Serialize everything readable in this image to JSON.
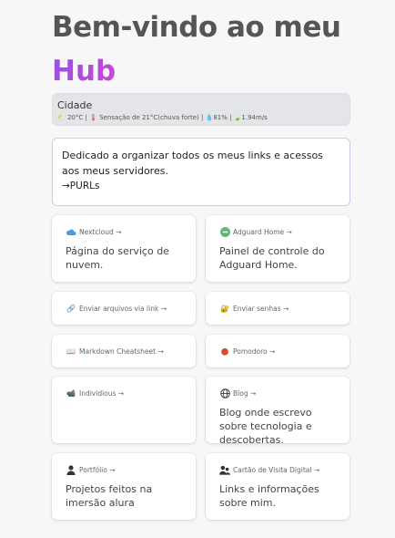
{
  "header": {
    "title": "Bem-vindo ao meu",
    "hub": "Hub"
  },
  "weather": {
    "city": "Cidade",
    "temp": "20°C",
    "feels": "Sensação de 21°C(chuva forte)",
    "humidity": "81%",
    "wind": "1.94m/s",
    "sep": "|"
  },
  "intro": {
    "text": "Dedicado a organizar todos os meus links e acessos aos meus servidores.",
    "link": "→PURLs"
  },
  "cards": [
    {
      "title": "Nextcloud →",
      "desc": "Página do serviço de nuvem.",
      "icon": "cloud-icon"
    },
    {
      "title": "Adguard Home →",
      "desc": "Painel de controle do Adguard Home.",
      "icon": "adguard-icon"
    },
    {
      "title": "Enviar arquivos via link →",
      "desc": "",
      "icon": "link-icon"
    },
    {
      "title": "Enviar senhas →",
      "desc": "",
      "icon": "key-lock-icon"
    },
    {
      "title": "Markdown Cheatsheet →",
      "desc": "",
      "icon": "notebook-icon"
    },
    {
      "title": "Pomodoro →",
      "desc": "",
      "icon": "tomato-icon"
    },
    {
      "title": "Individious →",
      "desc": "",
      "icon": "video-camera-icon"
    },
    {
      "title": "Blog →",
      "desc": "Blog onde escrevo sobre tecnologia e descobertas.",
      "icon": "globe-icon"
    },
    {
      "title": "Portfólio →",
      "desc": "Projetos feitos na imersão alura",
      "icon": "user-icon"
    },
    {
      "title": "Cartão de Visita Digital →",
      "desc": "Links e informações sobre mim.",
      "icon": "users-icon"
    }
  ]
}
